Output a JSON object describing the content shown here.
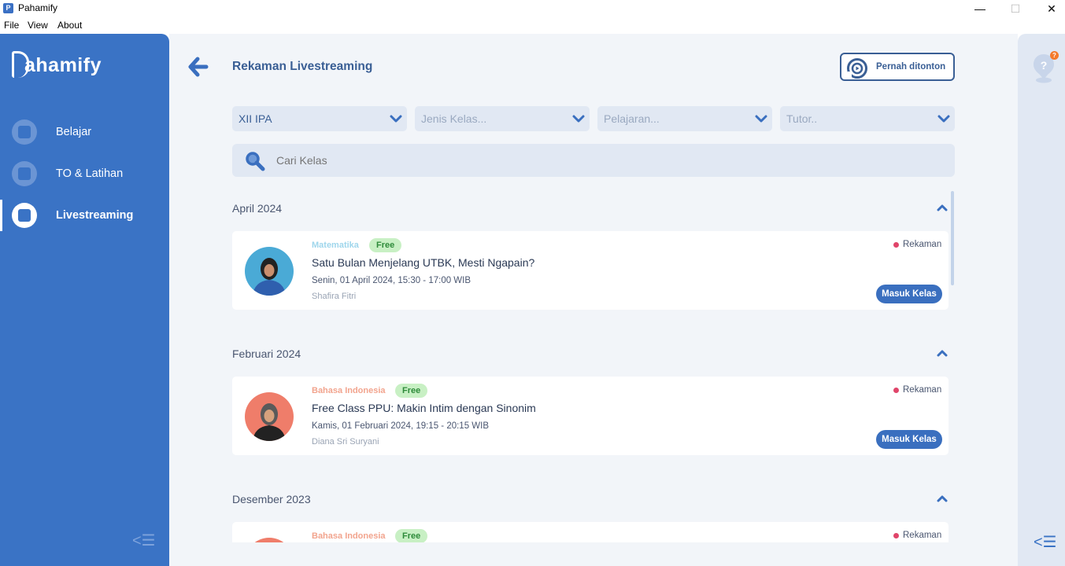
{
  "window": {
    "title": "Pahamify",
    "app_icon_glyph": "P",
    "minimize_glyph": "—",
    "maximize_glyph": "☐",
    "close_glyph": "✕"
  },
  "menu": [
    "File",
    "View",
    "About"
  ],
  "sidebar": {
    "logo": "ahamify",
    "items": [
      {
        "label": "Belajar",
        "icon": "book-icon",
        "active": false
      },
      {
        "label": "TO & Latihan",
        "icon": "clipboard-icon",
        "active": false
      },
      {
        "label": "Livestreaming",
        "icon": "livestream-icon",
        "active": true
      }
    ],
    "collapse_glyph": "<☰"
  },
  "header": {
    "title": "Rekaman Livestreaming",
    "watched_button": "Pernah ditonton"
  },
  "filters": [
    {
      "value": "XII IPA",
      "selected": true
    },
    {
      "value": "Jenis Kelas...",
      "selected": false
    },
    {
      "value": "Pelajaran...",
      "selected": false
    },
    {
      "value": "Tutor..",
      "selected": false
    }
  ],
  "search": {
    "placeholder": "Cari Kelas"
  },
  "groups": [
    {
      "month": "April 2024",
      "card": {
        "subject": "Matematika",
        "subject_color": "#9fd6ec",
        "badge": "Free",
        "title": "Satu Bulan Menjelang UTBK, Mesti Ngapain?",
        "date": "Senin, 01 April 2024, 15:30 - 17:00 WIB",
        "tutor": "Shafira Fitri",
        "status": "Rekaman",
        "button": "Masuk Kelas",
        "avatar_bg": "#4aaad6"
      }
    },
    {
      "month": "Februari 2024",
      "card": {
        "subject": "Bahasa Indonesia",
        "subject_color": "#f2a48e",
        "badge": "Free",
        "title": "Free Class PPU: Makin Intim dengan Sinonim",
        "date": "Kamis, 01 Februari 2024, 19:15 - 20:15 WIB",
        "tutor": "Diana Sri Suryani",
        "status": "Rekaman",
        "button": "Masuk Kelas",
        "avatar_bg": "#ef7d6a"
      }
    },
    {
      "month": "Desember 2023",
      "card": {
        "subject": "Bahasa Indonesia",
        "subject_color": "#f2a48e",
        "badge": "Free",
        "status": "Rekaman",
        "avatar_bg": "#ef7d6a"
      }
    }
  ],
  "right_panel": {
    "help_badge": "?",
    "collapse_glyph": "<☰"
  },
  "colors": {
    "primary": "#3a73c5",
    "title": "#3a5f95",
    "background": "#f2f5f9",
    "free_badge_bg": "#c8f0c4",
    "recording_dot": "#e0456a"
  }
}
